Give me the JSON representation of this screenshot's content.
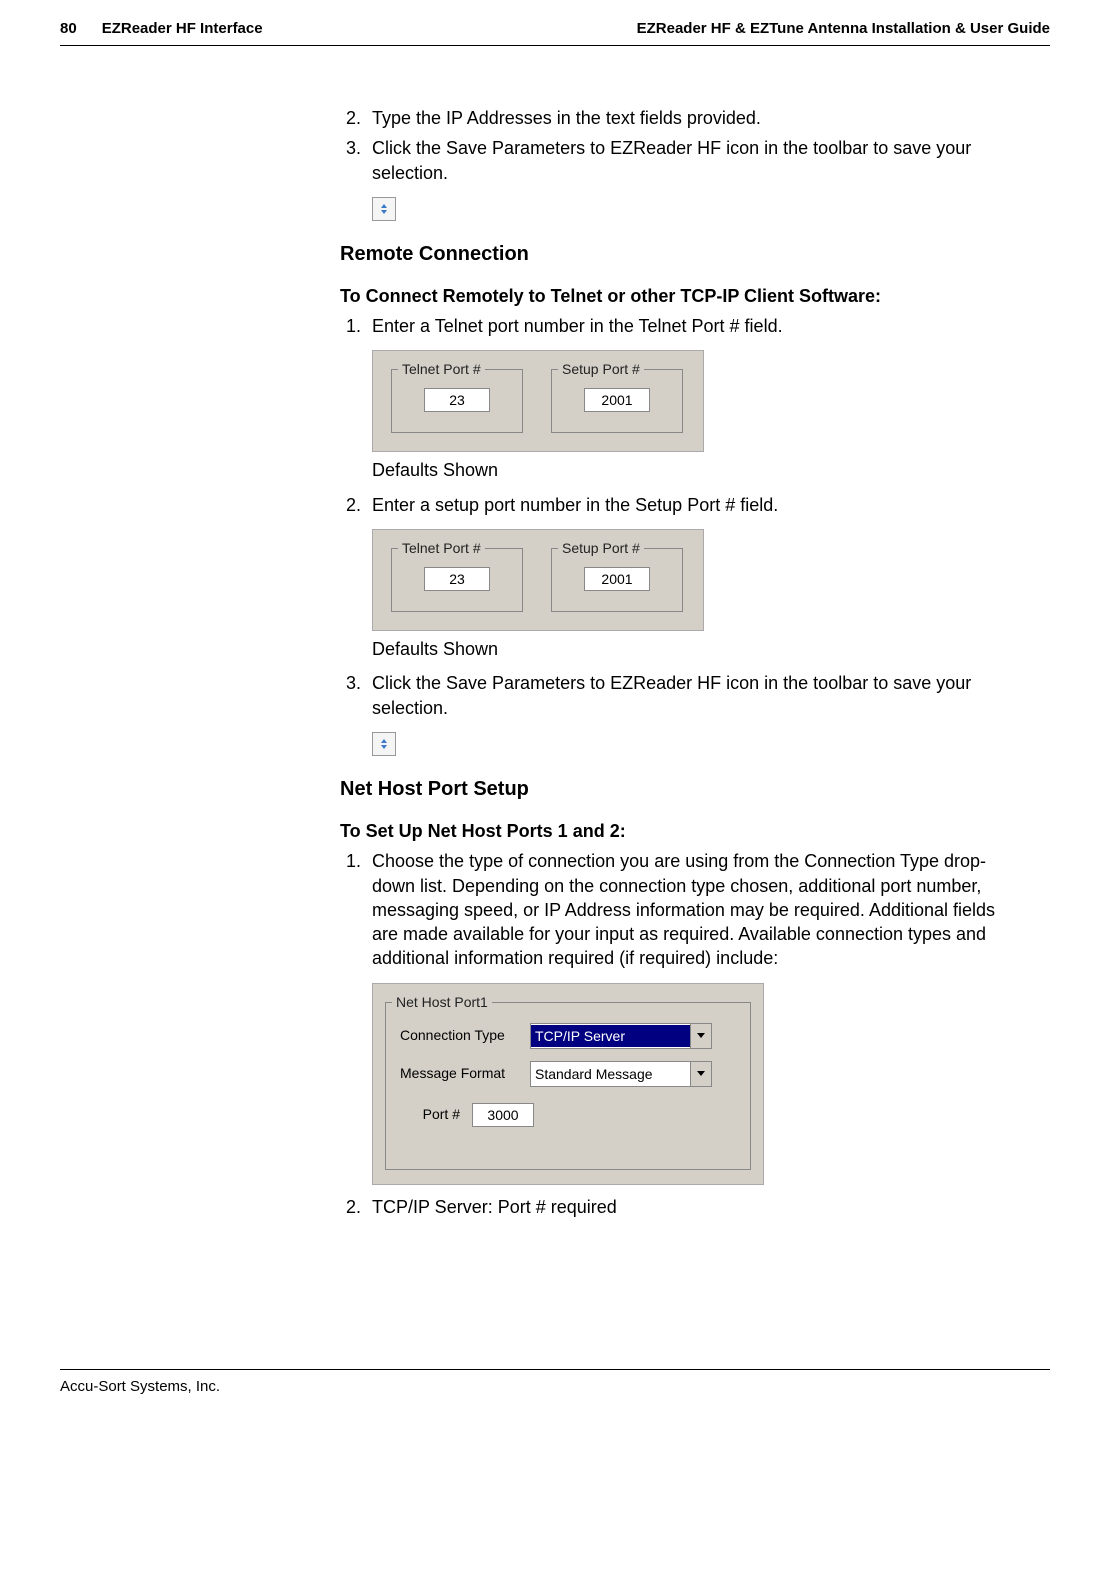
{
  "header": {
    "page_number": "80",
    "left_title": "EZReader HF Interface",
    "right_title": "EZReader HF & EZTune Antenna Installation & User Guide"
  },
  "section1": {
    "step2": "Type the IP Addresses in the text fields provided.",
    "step3": "Click the Save Parameters to EZReader HF icon in the toolbar to save your selection."
  },
  "section2": {
    "heading": "Remote Connection",
    "subheading": "To Connect Remotely to Telnet or other TCP-IP Client Software:",
    "step1": "Enter a Telnet port number in the Telnet Port # field.",
    "step2": "Enter a setup port number in the Setup Port # field.",
    "step3": "Click the Save Parameters to EZReader HF icon in the toolbar to save your selection.",
    "defaults_caption": "Defaults Shown",
    "telnet_label": "Telnet Port #",
    "telnet_value": "23",
    "setup_label": "Setup Port #",
    "setup_value": "2001"
  },
  "section3": {
    "heading": "Net Host Port Setup",
    "subheading": "To Set Up Net Host Ports 1 and 2:",
    "step1": "Choose the type of connection you are using from the Connection Type drop-down list. Depending on the connection type chosen, additional port number, messaging speed, or IP Address information may be required. Additional fields are made available for your input as required. Available connection types and additional information required (if required) include:",
    "step2": "TCP/IP Server: Port # required",
    "panel": {
      "legend": "Net Host Port1",
      "conn_type_label": "Connection Type",
      "conn_type_value": "TCP/IP Server",
      "msg_format_label": "Message Format",
      "msg_format_value": "Standard Message",
      "port_label": "Port #",
      "port_value": "3000"
    }
  },
  "footer": {
    "text": "Accu-Sort Systems, Inc."
  }
}
